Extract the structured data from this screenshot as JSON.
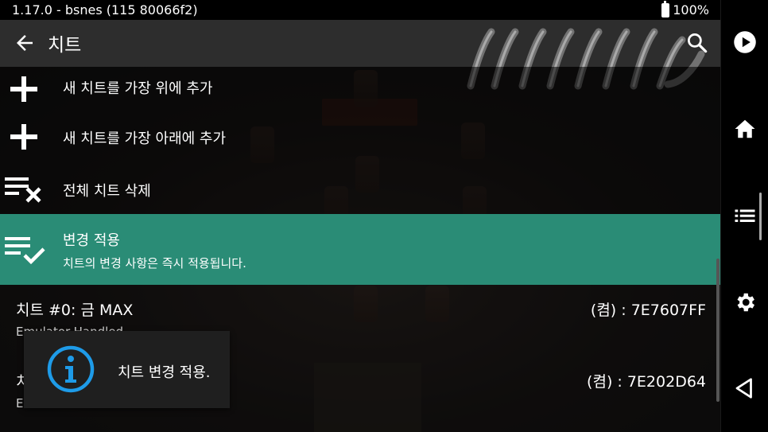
{
  "status_bar": {
    "version_text": "1.17.0 - bsnes (115 80066f2)",
    "battery_text": "100%"
  },
  "toolbar": {
    "title": "치트",
    "back_icon": "arrow-left-icon",
    "search_icon": "search-icon"
  },
  "menu": {
    "items": [
      {
        "label": "새 치트를 가장 위에 추가",
        "icon": "plus-icon"
      },
      {
        "label": "새 치트를 가장 아래에 추가",
        "icon": "plus-icon"
      },
      {
        "label": "전체 치트 삭제",
        "icon": "playlist-remove-icon"
      },
      {
        "label": "변경 적용",
        "sublabel": "치트의 변경 사항은 즉시 적용됩니다.",
        "icon": "playlist-check-icon",
        "selected": true
      }
    ]
  },
  "cheats": [
    {
      "name": "치트 #0: 금 MAX",
      "code": "(켬) : 7E7607FF",
      "desc": "Emulator-Handled"
    },
    {
      "name": "치",
      "code": "(켬) : 7E202D64",
      "desc": "E"
    }
  ],
  "toast": {
    "message": "치트 변경 적용.",
    "icon": "info-icon"
  },
  "navbar": {
    "icons": [
      "play-circle-icon",
      "home-icon",
      "list-icon",
      "gear-icon",
      "back-triangle-icon"
    ]
  },
  "colors": {
    "accent": "#2a8c76",
    "toolbar": "#2d2d2d",
    "info": "#1e9be8"
  }
}
